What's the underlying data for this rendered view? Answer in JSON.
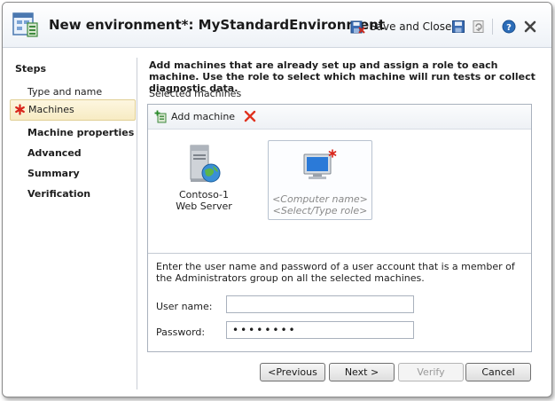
{
  "window": {
    "title": "New environment*: MyStandardEnvironment",
    "save_close_label": "Save and Close"
  },
  "steps": {
    "title": "Steps",
    "items": [
      {
        "label": "Type and name"
      },
      {
        "label": "Machines"
      },
      {
        "label": "Machine properties"
      },
      {
        "label": "Advanced"
      },
      {
        "label": "Summary"
      },
      {
        "label": "Verification"
      }
    ]
  },
  "main": {
    "instruction": "Add machines that are already set up and assign a role to each machine. Use the role to select which machine will run tests or collect diagnostic data.",
    "selected_label": "Selected machines",
    "add_machine_label": "Add machine",
    "machines": [
      {
        "name": "Contoso-1",
        "role": "Web Server"
      },
      {
        "name": "<Computer name>",
        "role": "<Select/Type role>"
      }
    ],
    "credentials_text": "Enter the user name and password of a user account that is a member of the Administrators group on all the selected machines.",
    "username_label": "User name:",
    "username_value": "",
    "password_label": "Password:",
    "password_value": "••••••••"
  },
  "buttons": {
    "previous": "<Previous",
    "next": "Next >",
    "verify": "Verify",
    "cancel": "Cancel"
  },
  "colors": {
    "selected_step_bg": "#f7ebc3",
    "error_red": "#d9261c",
    "accent_blue": "#2b6cb8"
  }
}
